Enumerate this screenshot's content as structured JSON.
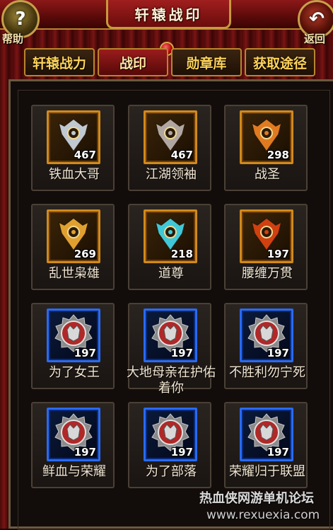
{
  "header": {
    "title": "轩辕战印",
    "help_icon": "question-mark-icon",
    "help_label": "帮助",
    "back_icon": "back-arrow-icon",
    "back_label": "返回"
  },
  "tabs": [
    {
      "label": "轩辕战力",
      "active": false
    },
    {
      "label": "战印",
      "active": true
    },
    {
      "label": "勋章库",
      "active": false
    },
    {
      "label": "获取途径",
      "active": false
    }
  ],
  "badges": [
    {
      "name": "铁血大哥",
      "count": "467",
      "frame": "gold",
      "icon": "silver-wing-emblem-icon"
    },
    {
      "name": "江湖领袖",
      "count": "467",
      "frame": "gold",
      "icon": "horned-skull-emblem-icon"
    },
    {
      "name": "战圣",
      "count": "298",
      "frame": "gold",
      "icon": "fire-eye-emblem-icon"
    },
    {
      "name": "乱世枭雄",
      "count": "269",
      "frame": "gold",
      "icon": "orange-crest-emblem-icon"
    },
    {
      "name": "道尊",
      "count": "218",
      "frame": "gold",
      "icon": "cyan-gem-emblem-icon"
    },
    {
      "name": "腰缠万贯",
      "count": "197",
      "frame": "gold",
      "icon": "spider-emblem-icon"
    },
    {
      "name": "为了女王",
      "count": "197",
      "frame": "blue",
      "icon": "horned-beast-medal-icon"
    },
    {
      "name": "大地母亲在护佑着你",
      "count": "197",
      "frame": "blue",
      "icon": "tauren-medal-icon"
    },
    {
      "name": "不胜利勿宁死",
      "count": "197",
      "frame": "blue",
      "icon": "lion-medal-icon"
    },
    {
      "name": "鲜血与荣耀",
      "count": "197",
      "frame": "blue",
      "icon": "axe-medal-icon"
    },
    {
      "name": "为了部落",
      "count": "197",
      "frame": "blue",
      "icon": "horde-medal-icon"
    },
    {
      "name": "荣耀归于联盟",
      "count": "197",
      "frame": "blue",
      "icon": "alliance-medal-icon"
    }
  ],
  "watermark": {
    "text": "热血侠网游单机论坛",
    "url": "www.rexuexia.com"
  },
  "colors": {
    "gold_frame": "#d08a1c",
    "blue_frame": "#2a6af0",
    "tab_text": "#ffd35a",
    "title_red": "#8c1818"
  }
}
